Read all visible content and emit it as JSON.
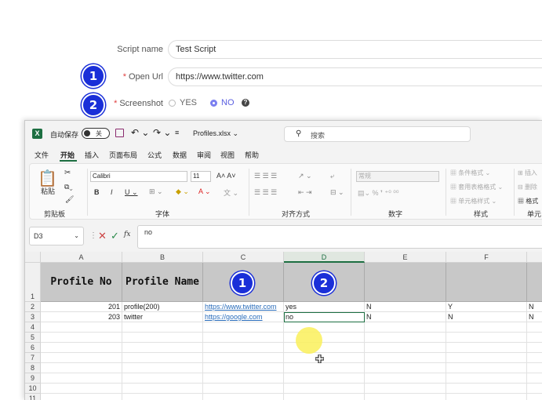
{
  "form": {
    "script_name_label": "Script name",
    "script_name_value": "Test Script",
    "open_url_label": "Open Url",
    "open_url_value": "https://www.twitter.com",
    "screenshot_label": "Screenshot",
    "yes_label": "YES",
    "no_label": "NO",
    "selected": "NO"
  },
  "badges": {
    "b1": "1",
    "b2": "2"
  },
  "excel": {
    "autosave_label": "自动保存",
    "autosave_state": "关",
    "filename": "Profiles.xlsx ⌄",
    "search_placeholder": "搜索",
    "menu": [
      "文件",
      "开始",
      "插入",
      "页面布局",
      "公式",
      "数据",
      "审阅",
      "视图",
      "帮助"
    ],
    "ribbon": {
      "paste": "粘贴",
      "clipboard": "剪贴板",
      "font_name": "Calibri",
      "font_size": "11",
      "font_group": "字体",
      "align_group": "对齐方式",
      "number_format": "常规",
      "number_group": "数字",
      "cond_format": "条件格式 ⌄",
      "table_format": "套用表格格式 ⌄",
      "cell_style": "单元格样式 ⌄",
      "style_group": "样式",
      "insert": "插入",
      "delete": "删除",
      "format": "格式",
      "cell_group": "单元"
    },
    "name_box": "D3",
    "formula_value": "no",
    "columns": [
      "A",
      "B",
      "C",
      "D",
      "E",
      "F"
    ],
    "rows": [
      "1",
      "2",
      "3",
      "4",
      "5",
      "6",
      "7",
      "8",
      "9",
      "10",
      "11"
    ],
    "header_row": {
      "A": "Profile No",
      "B": "Profile Name",
      "C_badge": "1",
      "D_badge": "2"
    },
    "data": [
      {
        "A": "201",
        "B": "profile(200)",
        "C": "https://www.twitter.com",
        "D": "yes",
        "E": "N",
        "F": "Y",
        "G": "N"
      },
      {
        "A": "203",
        "B": "twitter",
        "C": "https://google.com",
        "D": "no",
        "E": "N",
        "F": "N",
        "G": "N"
      }
    ]
  },
  "colors": {
    "badge": "#1a2fd8",
    "excel_green": "#1d6f42",
    "link": "#2a6dbb"
  }
}
